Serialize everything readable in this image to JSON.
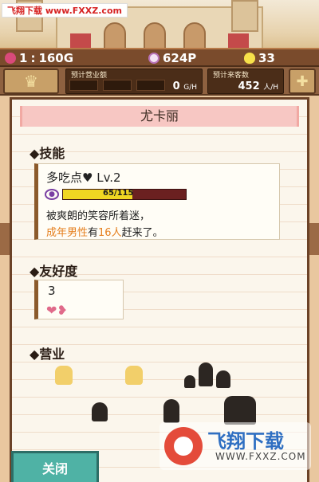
{
  "watermark_top": "飞翔下载 www.FXXZ.com",
  "stats": {
    "rank": "1",
    "gold": "160G",
    "points": "624P",
    "eggs": "33"
  },
  "estimates": {
    "revenue_label": "预计营业额",
    "revenue_value": "0",
    "revenue_unit": "G/H",
    "visitors_label": "预计来客数",
    "visitors_value": "452",
    "visitors_unit": "人/H"
  },
  "panel": {
    "title": "尤卡丽",
    "skill_heading": "◆技能",
    "skill_name": "多吃点♥ Lv.2",
    "xp_text": "65/115",
    "xp_fraction": 0.565,
    "desc_line1": "被爽朗的笑容所着迷，",
    "desc_line2_prefix": "成年男性",
    "desc_line2_mid": "有",
    "desc_line2_count": "16人",
    "desc_line2_suffix": "赶来了。",
    "friend_heading": "◆友好度",
    "friend_value": "3",
    "business_heading": "◆营业"
  },
  "close_button": "关闭",
  "watermark_bottom": {
    "title": "飞翔下载",
    "url": "WWW.FXXZ.COM"
  },
  "colors": {
    "accent": "#4fb2a5",
    "title_bar": "#f7c7c3",
    "orange_text": "#e57f1e"
  },
  "icons": [
    "crown-icon",
    "plus-icon",
    "heart-icon",
    "xp-icon",
    "gold-icon",
    "points-icon",
    "egg-icon"
  ]
}
